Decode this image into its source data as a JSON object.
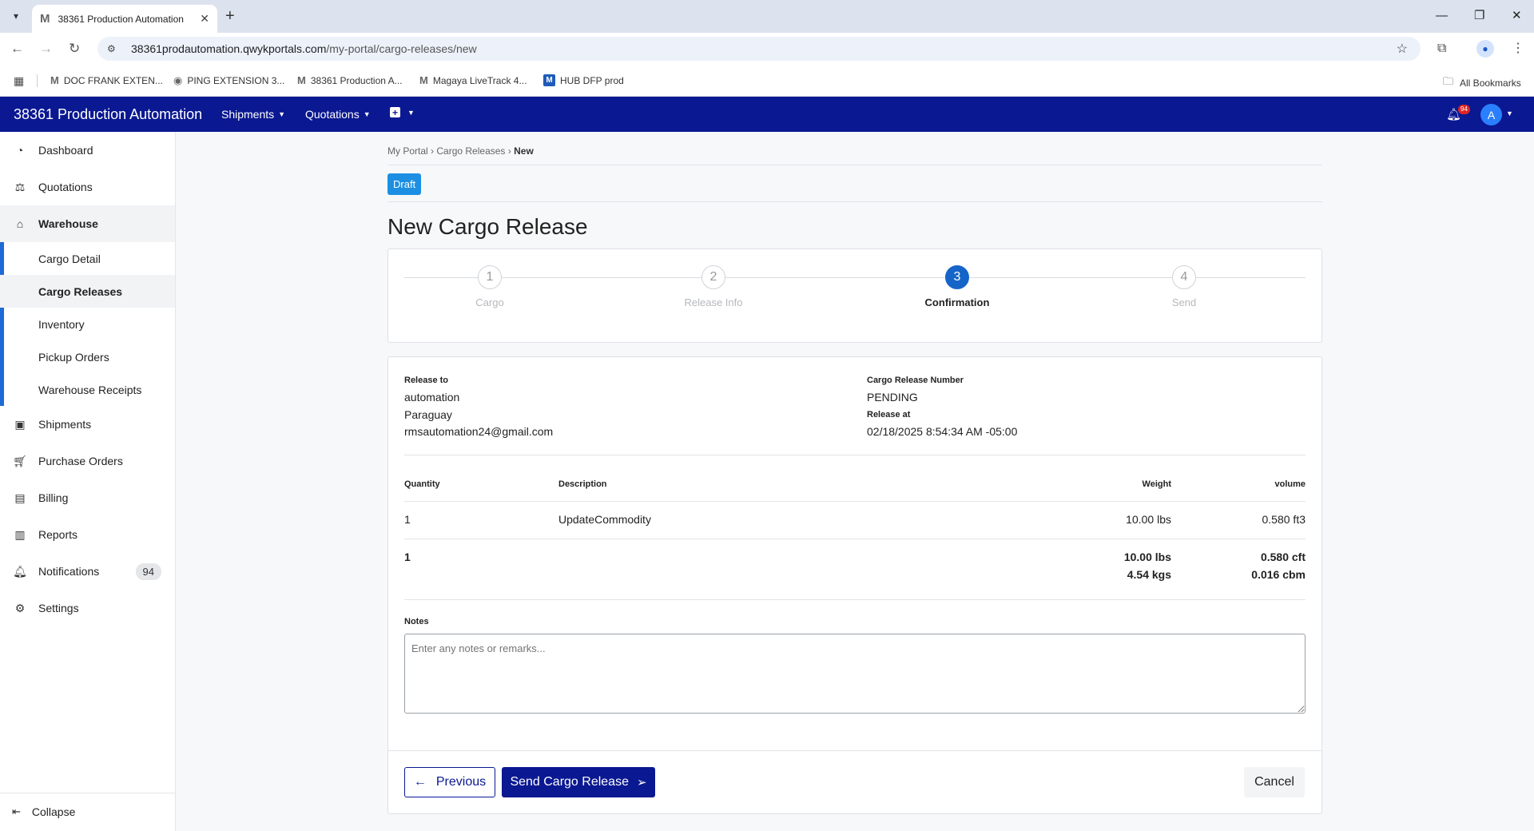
{
  "browser": {
    "tab_title": "38361 Production Automation",
    "tab_favicon": "M",
    "url_host": "38361prodautomation.qwykportals.com",
    "url_path": "/my-portal/cargo-releases/new",
    "bookmarks": [
      {
        "icon": "M",
        "label": "DOC FRANK EXTEN..."
      },
      {
        "icon": "globe",
        "label": "PING EXTENSION 3..."
      },
      {
        "icon": "M",
        "label": "38361 Production A..."
      },
      {
        "icon": "M",
        "label": "Magaya LiveTrack 4..."
      },
      {
        "icon": "hub",
        "label": "HUB DFP prod"
      }
    ],
    "all_bookmarks": "All Bookmarks"
  },
  "navbar": {
    "brand": "38361 Production Automation",
    "menus": [
      "Shipments",
      "Quotations"
    ],
    "notification_count": "94",
    "avatar_initial": "A"
  },
  "sidebar": {
    "items": [
      {
        "label": "Dashboard",
        "icon": "dashboard-icon"
      },
      {
        "label": "Quotations",
        "icon": "quotations-icon"
      },
      {
        "label": "Warehouse",
        "icon": "warehouse-icon"
      },
      {
        "label": "Shipments",
        "icon": "shipments-icon"
      },
      {
        "label": "Purchase Orders",
        "icon": "cart-icon"
      },
      {
        "label": "Billing",
        "icon": "billing-icon"
      },
      {
        "label": "Reports",
        "icon": "reports-icon"
      },
      {
        "label": "Notifications",
        "icon": "bell-icon",
        "count": "94"
      },
      {
        "label": "Settings",
        "icon": "gear-icon"
      }
    ],
    "warehouse_sub": [
      "Cargo Detail",
      "Cargo Releases",
      "Inventory",
      "Pickup Orders",
      "Warehouse Receipts"
    ],
    "collapse": "Collapse"
  },
  "breadcrumb": {
    "items": [
      "My Portal",
      "Cargo Releases"
    ],
    "current": "New"
  },
  "status_badge": "Draft",
  "page_title": "New Cargo Release",
  "steps": [
    {
      "num": "1",
      "label": "Cargo"
    },
    {
      "num": "2",
      "label": "Release Info"
    },
    {
      "num": "3",
      "label": "Confirmation"
    },
    {
      "num": "4",
      "label": "Send"
    }
  ],
  "active_step": 3,
  "release": {
    "release_to_label": "Release to",
    "name": "automation",
    "country": "Paraguay",
    "email": "rmsautomation24@gmail.com",
    "number_label": "Cargo Release Number",
    "number": "PENDING",
    "release_at_label": "Release at",
    "release_at": "02/18/2025 8:54:34 AM -05:00"
  },
  "table": {
    "headers": {
      "quantity": "Quantity",
      "description": "Description",
      "weight": "Weight",
      "volume": "volume"
    },
    "rows": [
      {
        "quantity": "1",
        "description": "UpdateCommodity",
        "weight": "10.00 lbs",
        "volume": "0.580 ft3"
      }
    ],
    "totals": {
      "quantity": "1",
      "weight_lbs": "10.00 lbs",
      "weight_kgs": "4.54 kgs",
      "volume_cft": "0.580 cft",
      "volume_cbm": "0.016 cbm"
    }
  },
  "notes": {
    "label": "Notes",
    "placeholder": "Enter any notes or remarks..."
  },
  "actions": {
    "previous": "Previous",
    "send": "Send Cargo Release",
    "cancel": "Cancel"
  }
}
